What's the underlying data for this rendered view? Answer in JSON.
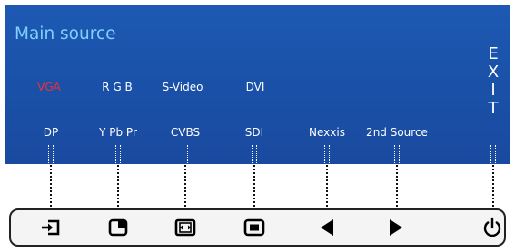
{
  "osd": {
    "title": "Main source",
    "sources_row1": [
      "VGA",
      "R G B",
      "S-Video",
      "DVI"
    ],
    "sources_row2": [
      "DP",
      "Y Pb Pr",
      "CVBS",
      "SDI",
      "Nexxis",
      "2nd Source"
    ],
    "active_source": "VGA",
    "exit_letters": [
      "E",
      "X",
      "I",
      "T"
    ]
  },
  "buttons": [
    {
      "name": "input-icon"
    },
    {
      "name": "pip-icon"
    },
    {
      "name": "picture-mode-icon"
    },
    {
      "name": "screen-icon"
    },
    {
      "name": "left-arrow-icon"
    },
    {
      "name": "right-arrow-icon"
    },
    {
      "name": "power-icon"
    }
  ],
  "colors": {
    "panel": "#1a50a7",
    "title": "#7fd0ff",
    "active": "#e8323b"
  }
}
